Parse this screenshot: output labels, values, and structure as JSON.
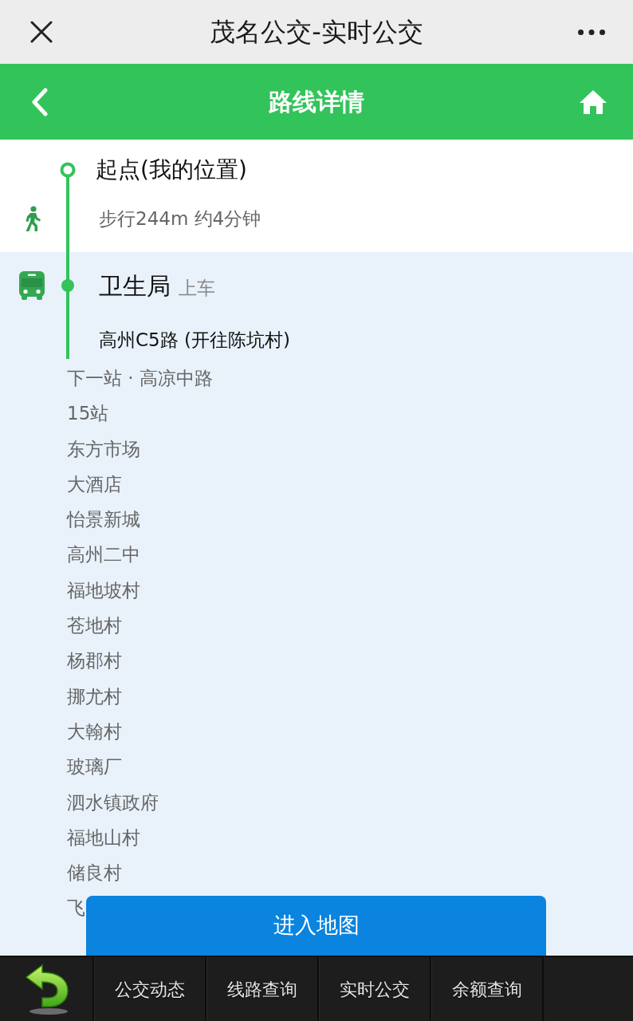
{
  "window": {
    "title": "茂名公交-实时公交"
  },
  "header": {
    "title": "路线详情"
  },
  "segments": [
    {
      "kind": "walk",
      "stop": "起点(我的位置)",
      "detail": "步行244m 约4分钟"
    },
    {
      "kind": "bus",
      "stop": "卫生局",
      "action": "上车",
      "line": "高州C5路 (开往陈坑村)",
      "stops": [
        "下一站 · 高凉中路",
        "15站",
        "东方市场",
        "大酒店",
        "怡景新城",
        "高州二中",
        "福地坡村",
        "苍地村",
        "杨郡村",
        "挪尤村",
        "大翰村",
        "玻璃厂",
        "泗水镇政府",
        "福地山村",
        "储良村",
        "飞"
      ]
    }
  ],
  "map_button": {
    "label": "进入地图"
  },
  "bottom_bar": {
    "items": [
      {
        "kind": "back"
      },
      {
        "kind": "tab",
        "label": "公交动态"
      },
      {
        "kind": "tab",
        "label": "线路查询"
      },
      {
        "kind": "tab",
        "label": "实时公交"
      },
      {
        "kind": "tab",
        "label": "余额查询"
      }
    ]
  }
}
